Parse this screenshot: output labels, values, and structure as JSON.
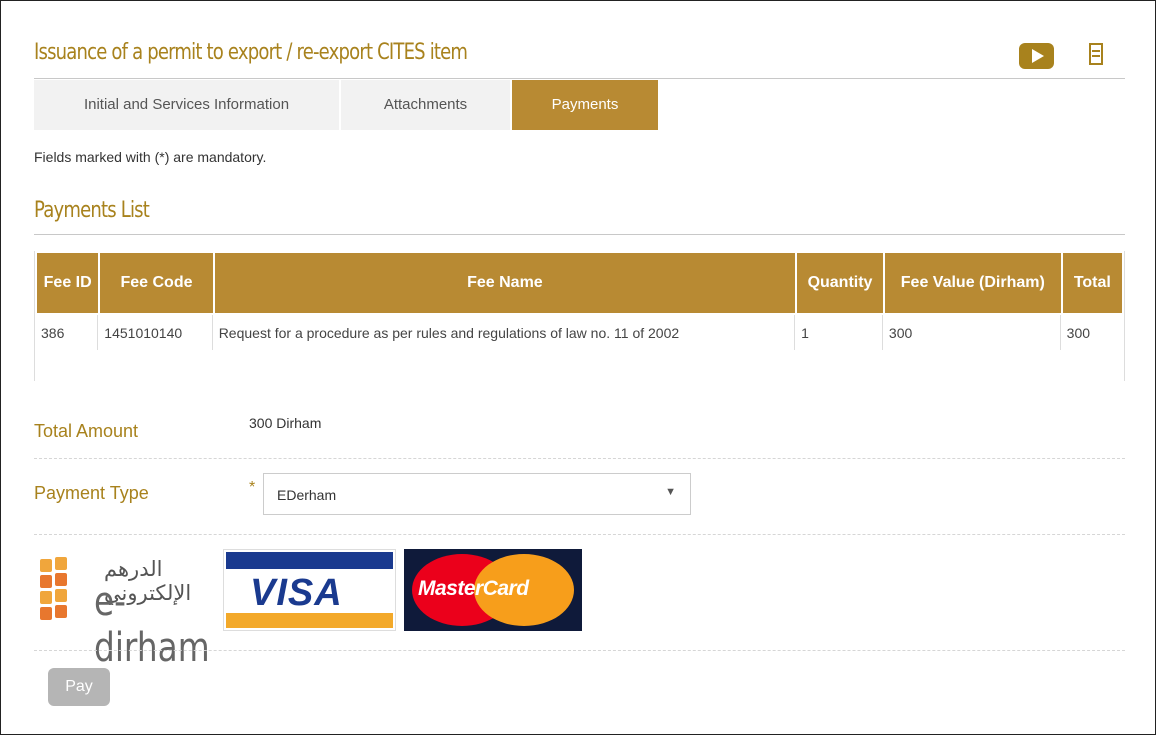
{
  "page": {
    "title": "Issuance of a permit to export / re-export CITES item",
    "mandatory_note": "Fields marked with (*) are mandatory."
  },
  "icons": {
    "video": "play-video-icon",
    "document": "document-list-icon"
  },
  "tabs": [
    {
      "label": "Initial and Services Information",
      "active": false
    },
    {
      "label": "Attachments",
      "active": false
    },
    {
      "label": "Payments",
      "active": true
    }
  ],
  "payments": {
    "section_title": "Payments List",
    "columns": [
      "Fee ID",
      "Fee Code",
      "Fee Name",
      "Quantity",
      "Fee Value (Dirham)",
      "Total"
    ],
    "rows": [
      {
        "fee_id": "386",
        "fee_code": "1451010140",
        "fee_name": "Request for a procedure as per rules and regulations of law no. 11 of 2002",
        "quantity": "1",
        "fee_value": "300",
        "total": "300"
      }
    ]
  },
  "form": {
    "total_amount_label": "Total Amount",
    "total_amount_value": "300 Dirham",
    "payment_type_label": "Payment Type",
    "required_mark": "*",
    "payment_type_value": "EDerham",
    "select_arrow": "▼"
  },
  "logos": {
    "edirham_arabic": "الدرهم الإلكتروني",
    "edirham_latin": "e-dirham",
    "visa": "VISA",
    "mastercard": "MasterCard"
  },
  "actions": {
    "pay_label": "Pay"
  },
  "colors": {
    "accent": "#a8821d",
    "tab_active": "#b88a33",
    "button_disabled": "#b5b5b5"
  }
}
